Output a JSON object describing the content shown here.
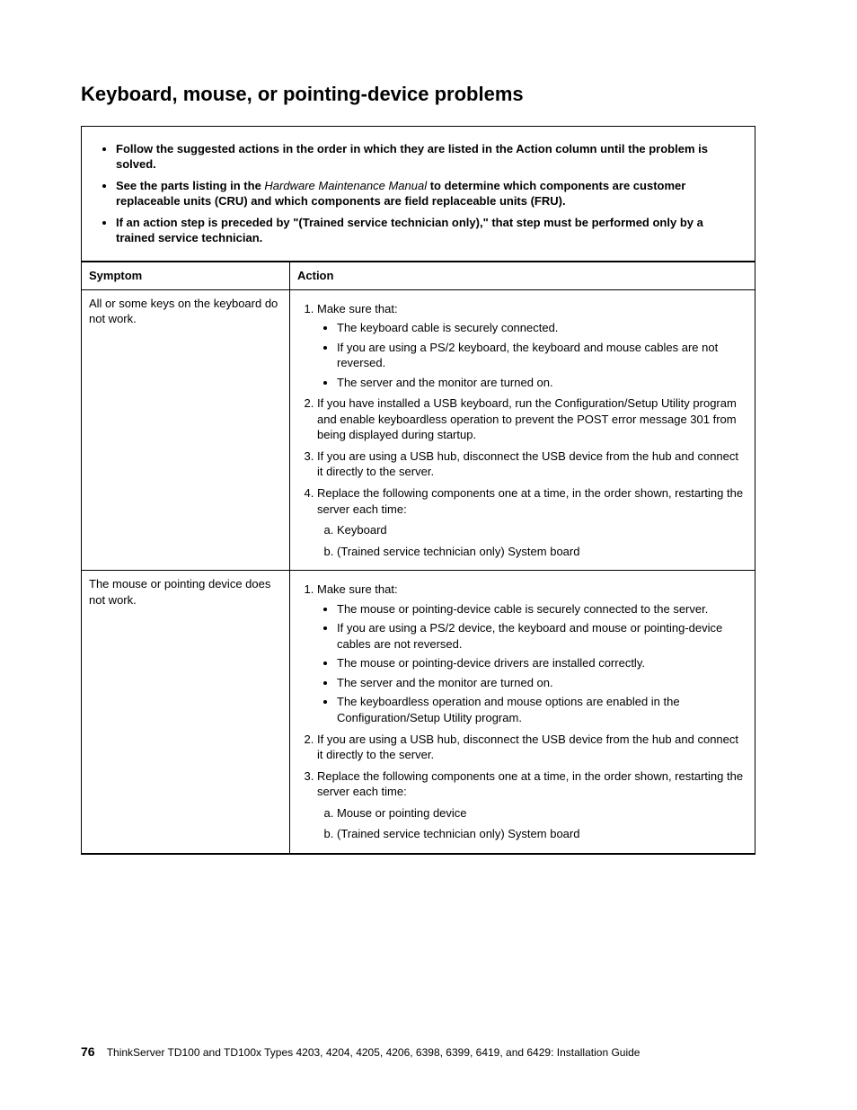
{
  "heading": "Keyboard, mouse, or pointing-device problems",
  "intro": {
    "note1_pre": "Follow the suggested actions in the order in which they are listed in the Action column until the problem is solved.",
    "note2_pre": "See the parts listing in the ",
    "note2_em": "Hardware Maintenance Manual",
    "note2_post": " to determine which components are customer replaceable units (CRU) and which components are field replaceable units (FRU).",
    "note3": "If an action step is preceded by \"(Trained service technician only),\" that step must be performed only by a trained service technician."
  },
  "thead": {
    "symptom": "Symptom",
    "action": "Action"
  },
  "row1": {
    "symptom": "All or some keys on the keyboard do not work.",
    "s1_lead": "Make sure that:",
    "s1_b1": "The keyboard cable is securely connected.",
    "s1_b2": "If you are using a PS/2 keyboard, the keyboard and mouse cables are not reversed.",
    "s1_b3": "The server and the monitor are turned on.",
    "s2": "If you have installed a USB keyboard, run the Configuration/Setup Utility program and enable keyboardless operation to prevent the POST error message 301 from being displayed during startup.",
    "s3": "If you are using a USB hub, disconnect the USB device from the hub and connect it directly to the server.",
    "s4_lead": "Replace the following components one at a time, in the order shown, restarting the server each time:",
    "s4_a": "Keyboard",
    "s4_b": "(Trained service technician only) System board"
  },
  "row2": {
    "symptom": "The mouse or pointing device does not work.",
    "s1_lead": "Make sure that:",
    "s1_b1": "The mouse or pointing-device cable is securely connected to the server.",
    "s1_b2": "If you are using a PS/2 device, the keyboard and mouse or pointing-device cables are not reversed.",
    "s1_b3": "The mouse or pointing-device drivers are installed correctly.",
    "s1_b4": "The server and the monitor are turned on.",
    "s1_b5": "The keyboardless operation and mouse options are enabled in the Configuration/Setup Utility program.",
    "s2": "If you are using a USB hub, disconnect the USB device from the hub and connect it directly to the server.",
    "s3_lead": "Replace the following components one at a time, in the order shown, restarting the server each time:",
    "s3_a": "Mouse or pointing device",
    "s3_b": "(Trained service technician only) System board"
  },
  "footer": {
    "page": "76",
    "text": "ThinkServer TD100 and TD100x Types 4203, 4204, 4205, 4206, 6398, 6399, 6419, and 6429: Installation Guide"
  }
}
